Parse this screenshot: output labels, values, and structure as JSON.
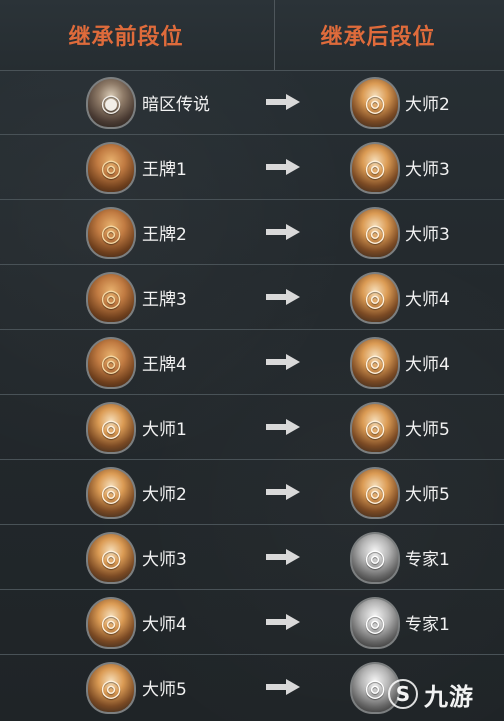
{
  "header": {
    "left_title": "继承前段位",
    "right_title": "继承后段位"
  },
  "rows": [
    {
      "before": {
        "icon": "dark-legend-badge",
        "label": "暗区传说"
      },
      "after": {
        "icon": "tiger-badge",
        "label": "大师2"
      }
    },
    {
      "before": {
        "icon": "lion-badge",
        "label": "王牌1"
      },
      "after": {
        "icon": "tiger-badge",
        "label": "大师3"
      }
    },
    {
      "before": {
        "icon": "lion-badge",
        "label": "王牌2"
      },
      "after": {
        "icon": "tiger-badge",
        "label": "大师3"
      }
    },
    {
      "before": {
        "icon": "lion-badge",
        "label": "王牌3"
      },
      "after": {
        "icon": "tiger-badge",
        "label": "大师4"
      }
    },
    {
      "before": {
        "icon": "lion-badge",
        "label": "王牌4"
      },
      "after": {
        "icon": "tiger-badge",
        "label": "大师4"
      }
    },
    {
      "before": {
        "icon": "tiger-badge",
        "label": "大师1"
      },
      "after": {
        "icon": "tiger-badge",
        "label": "大师5"
      }
    },
    {
      "before": {
        "icon": "tiger-badge",
        "label": "大师2"
      },
      "after": {
        "icon": "tiger-badge",
        "label": "大师5"
      }
    },
    {
      "before": {
        "icon": "tiger-badge",
        "label": "大师3"
      },
      "after": {
        "icon": "wolf-badge",
        "label": "专家1"
      }
    },
    {
      "before": {
        "icon": "tiger-badge",
        "label": "大师4"
      },
      "after": {
        "icon": "wolf-badge",
        "label": "专家1"
      }
    },
    {
      "before": {
        "icon": "tiger-badge",
        "label": "大师5"
      },
      "after": {
        "icon": "wolf-badge",
        "label": ""
      }
    }
  ],
  "watermark": {
    "text": "九游"
  }
}
